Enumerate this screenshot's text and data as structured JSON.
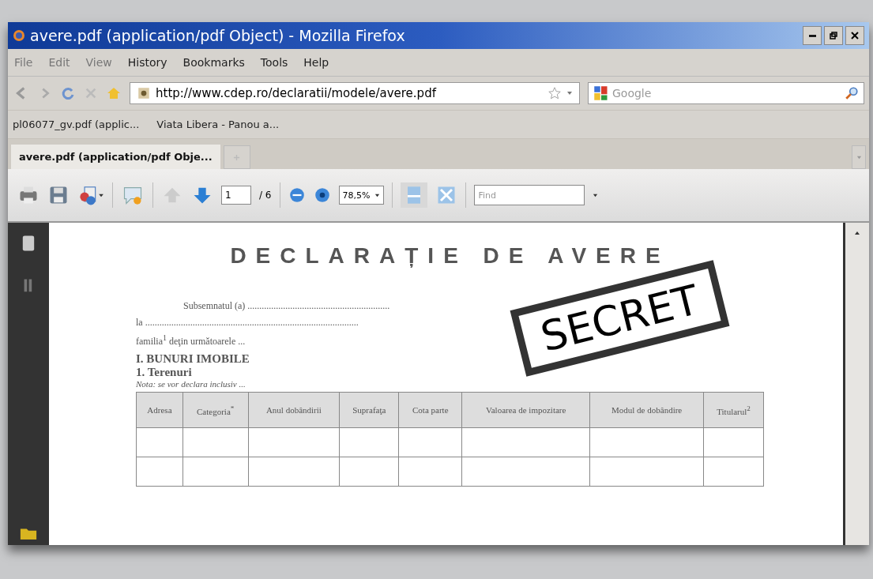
{
  "window": {
    "title": "avere.pdf (application/pdf Object) - Mozilla Firefox"
  },
  "menu": [
    {
      "label": "File",
      "disabled": true
    },
    {
      "label": "Edit",
      "disabled": true
    },
    {
      "label": "View",
      "disabled": true
    },
    {
      "label": "History",
      "disabled": false
    },
    {
      "label": "Bookmarks",
      "disabled": false
    },
    {
      "label": "Tools",
      "disabled": false
    },
    {
      "label": "Help",
      "disabled": false
    }
  ],
  "address": {
    "value": "http://www.cdep.ro/declaratii/modele/avere.pdf"
  },
  "search": {
    "placeholder": "Google"
  },
  "bookmarks": [
    "pl06077_gv.pdf (applic...",
    "Viata Libera - Panou a..."
  ],
  "tabs": [
    {
      "label": "avere.pdf (application/pdf Obje...",
      "selected": true
    }
  ],
  "pdf_toolbar": {
    "page": "1",
    "page_total": "/ 6",
    "zoom": "78,5%",
    "find_placeholder": "Find"
  },
  "document": {
    "title": "DECLARAȚIE DE AVERE",
    "paragraph": [
      "Subsemnatul (a) ............................................................",
      "la ..........................................................................................",
      "familia$^{1}$ deţin următoarele ..."
    ],
    "section": "I. BUNURI IMOBILE",
    "subsection": "1. Terenuri",
    "note": "Nota: se vor declara inclusiv ...",
    "columns": [
      "Adresa",
      "Categoria$^{*}$",
      "Anul dobândirii",
      "Suprafaţa",
      "Cota parte",
      "Valoarea de impozitare",
      "Modul de dobândire",
      "Titularul$^{2}$"
    ]
  },
  "stamp": {
    "text": "SECRET"
  }
}
